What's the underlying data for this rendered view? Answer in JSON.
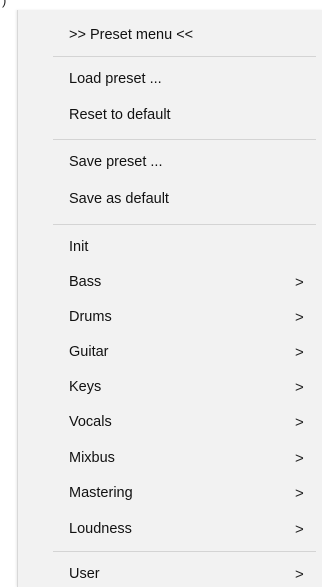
{
  "menu": {
    "header": ">> Preset menu <<",
    "items": [
      {
        "label": "Load preset ..."
      },
      {
        "label": "Reset to default"
      },
      {
        "label": "Save preset ..."
      },
      {
        "label": "Save as default"
      },
      {
        "label": "Init"
      },
      {
        "label": "Bass",
        "submenu_icon": ">"
      },
      {
        "label": "Drums",
        "submenu_icon": ">"
      },
      {
        "label": "Guitar",
        "submenu_icon": ">"
      },
      {
        "label": "Keys",
        "submenu_icon": ">"
      },
      {
        "label": "Vocals",
        "submenu_icon": ">"
      },
      {
        "label": "Mixbus",
        "submenu_icon": ">"
      },
      {
        "label": "Mastering",
        "submenu_icon": ">"
      },
      {
        "label": "Loudness",
        "submenu_icon": ">"
      },
      {
        "label": "User",
        "submenu_icon": ">"
      }
    ]
  },
  "corner_glyph": ")"
}
